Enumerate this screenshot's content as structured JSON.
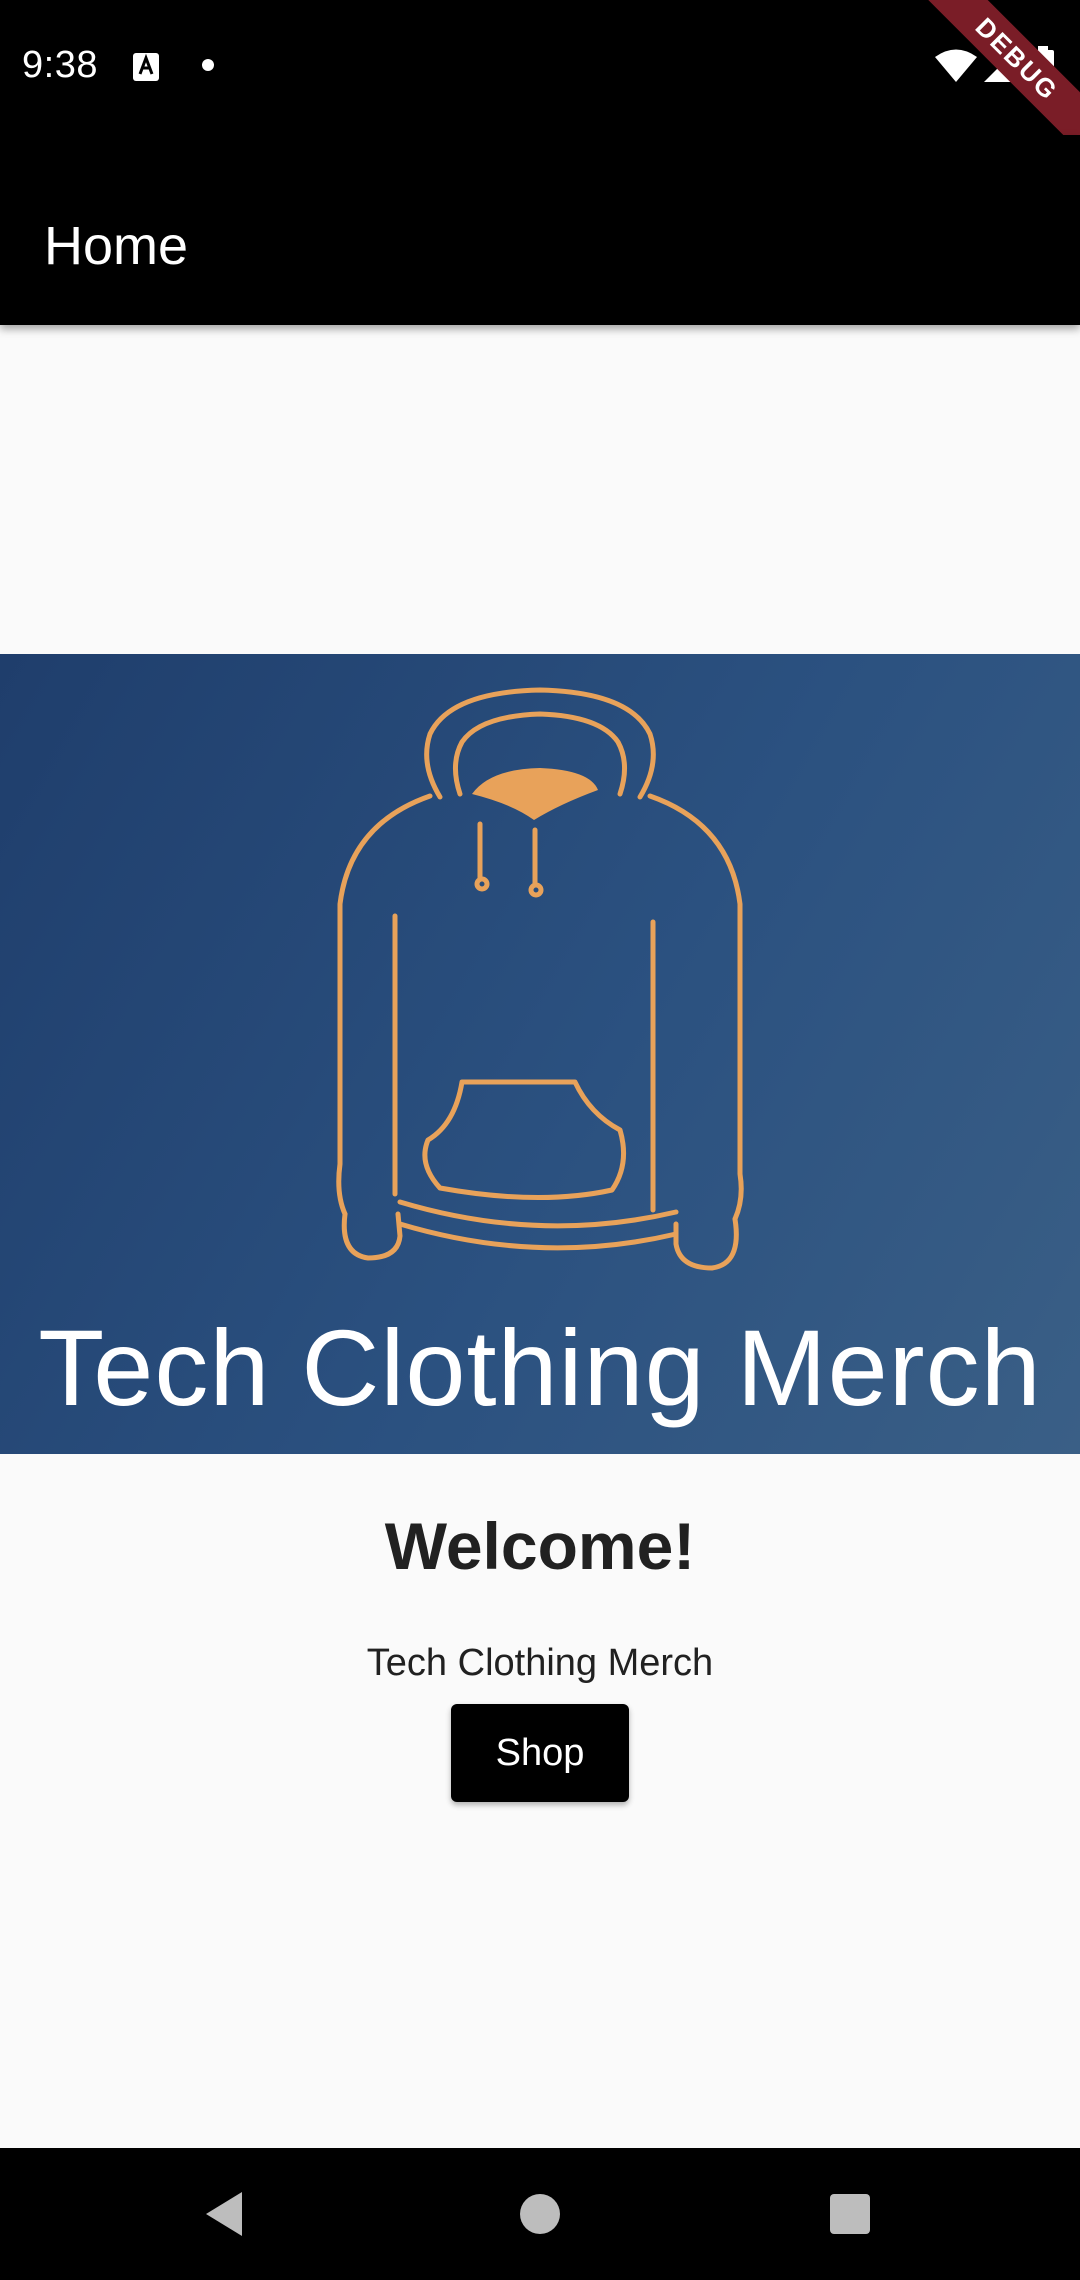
{
  "status_bar": {
    "time": "9:38",
    "notification_icon": "a-keyboard-icon",
    "icons": [
      "wifi-icon",
      "signal-icon",
      "battery-icon"
    ]
  },
  "debug_banner": {
    "label": "DEBUG"
  },
  "app_bar": {
    "title": "Home"
  },
  "hero": {
    "caption": "Tech Clothing Merch",
    "illustration": "hoodie-logo",
    "colors": {
      "background": "#2b5180",
      "accent": "#e8a25a"
    }
  },
  "content": {
    "welcome": "Welcome!",
    "subtitle": "Tech Clothing Merch",
    "shop_button": "Shop"
  },
  "nav_bar": {
    "icons": [
      "back-icon",
      "home-icon",
      "recents-icon"
    ]
  }
}
